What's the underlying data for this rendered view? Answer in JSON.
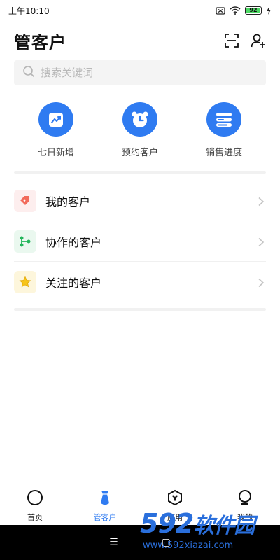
{
  "status_bar": {
    "time": "上午10:10",
    "battery": "92"
  },
  "header": {
    "title": "管客户"
  },
  "search": {
    "placeholder": "搜索关键词"
  },
  "quick_actions": [
    {
      "label": "七日新增",
      "icon": "trend-chart-icon"
    },
    {
      "label": "预约客户",
      "icon": "alarm-clock-icon"
    },
    {
      "label": "销售进度",
      "icon": "progress-list-icon"
    }
  ],
  "list": [
    {
      "label": "我的客户",
      "icon": "heart-tag-icon",
      "color": "#f26b5b",
      "bg": "#fdeeee"
    },
    {
      "label": "协作的客户",
      "icon": "share-nodes-icon",
      "color": "#22b55a",
      "bg": "#eaf8ef"
    },
    {
      "label": "关注的客户",
      "icon": "star-icon",
      "color": "#f7c419",
      "bg": "#fdf6dc"
    }
  ],
  "bottom_nav": [
    {
      "label": "首页",
      "icon": "home-circle-icon",
      "active": false
    },
    {
      "label": "管客户",
      "icon": "tie-icon",
      "active": true
    },
    {
      "label": "应用",
      "icon": "apps-hexagon-icon",
      "active": false
    },
    {
      "label": "我的",
      "icon": "profile-icon",
      "active": false
    }
  ],
  "system_bar": {
    "menu": "☰",
    "home": "▢"
  },
  "watermark": {
    "logo": "592",
    "logo_cn": "软件园",
    "url": "www.592xiazai.com"
  },
  "colors": {
    "accent": "#2f7bf1"
  }
}
